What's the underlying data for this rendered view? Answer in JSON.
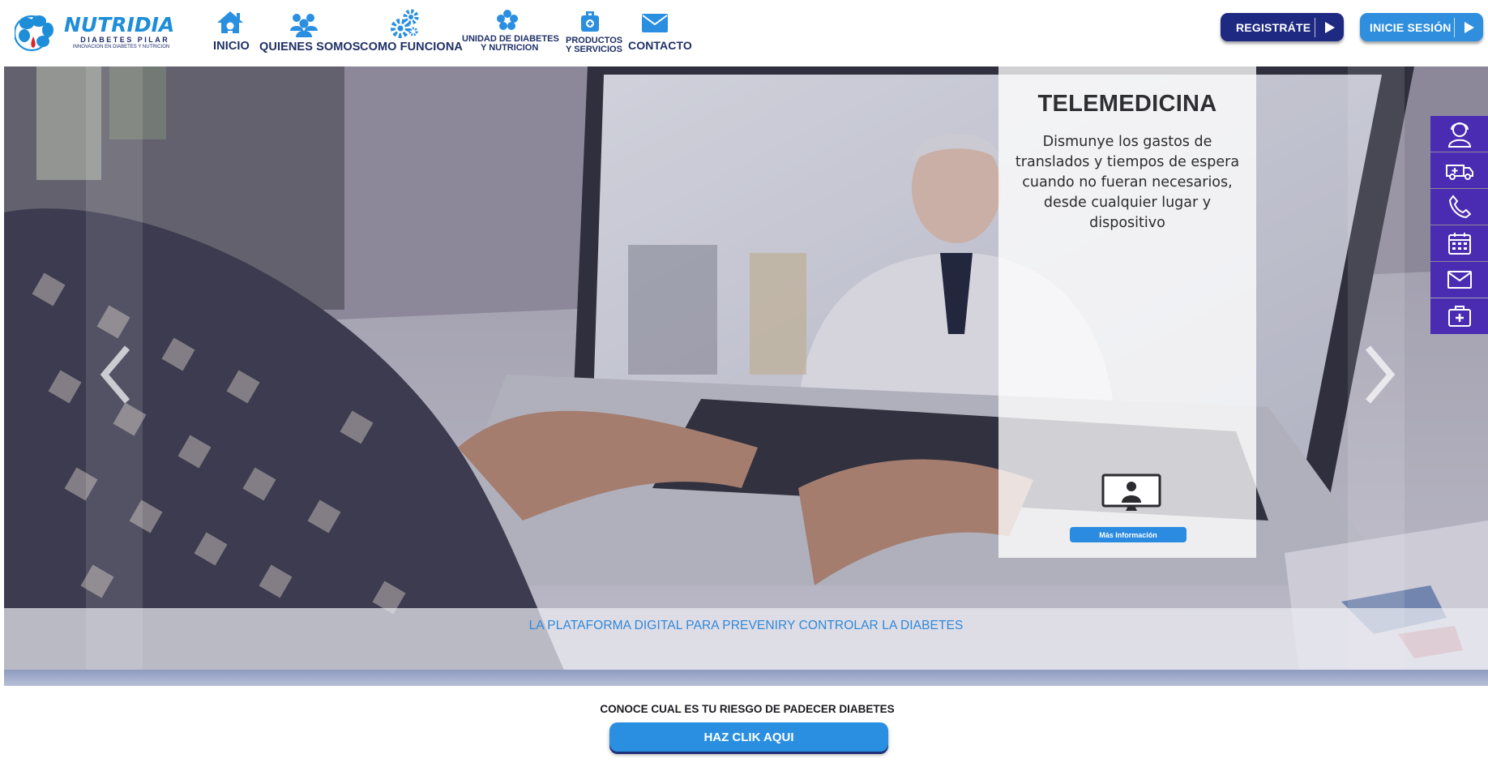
{
  "logo": {
    "title": "NUTRIDIA",
    "subtitle": "DIABETES PILAR",
    "tagline": "INNOVACION EN DIABETES Y NUTRICION"
  },
  "nav": {
    "items": [
      {
        "label": "INICIO",
        "icon": "home-icon"
      },
      {
        "label": "QUIENES SOMOS",
        "icon": "people-icon"
      },
      {
        "label": "COMO FUNCIONA",
        "icon": "gears-icon"
      },
      {
        "label_line1": "UNIDAD DE DIABETES",
        "label_line2": "Y NUTRICION",
        "icon": "flower-icon"
      },
      {
        "label_line1": "PRODUCTOS",
        "label_line2": "Y SERVICIOS",
        "icon": "medical-bag-icon"
      },
      {
        "label": "CONTACTO",
        "icon": "envelope-icon"
      }
    ]
  },
  "buttons": {
    "register": "REGISTRÁTE",
    "login": "INICIE SESIÓN"
  },
  "hero": {
    "panel_title": "TELEMEDICINA",
    "panel_text": "Dismunye los gastos de translados y tiempos de espera cuando no fueran necesarios, desde cualquier lugar y dispositivo",
    "panel_button": "Más Información",
    "tagline": "LA PLATAFORMA DIGITAL PARA PREVENIRY CONTROLAR LA DIABETES"
  },
  "side_menu": [
    "doctor-icon",
    "ambulance-icon",
    "phone-icon",
    "calendar-icon",
    "mail-icon",
    "first-aid-kit-icon"
  ],
  "bottom": {
    "risk_text": "CONOCE CUAL ES TU RIESGO DE PADECER DIABETES",
    "cta": "HAZ CLIK AQUI"
  },
  "colors": {
    "brand_blue": "#2a8fe0",
    "navy": "#1e2a82",
    "side_menu_purple": "#4a2cb3",
    "nav_text": "#1f2f66"
  }
}
